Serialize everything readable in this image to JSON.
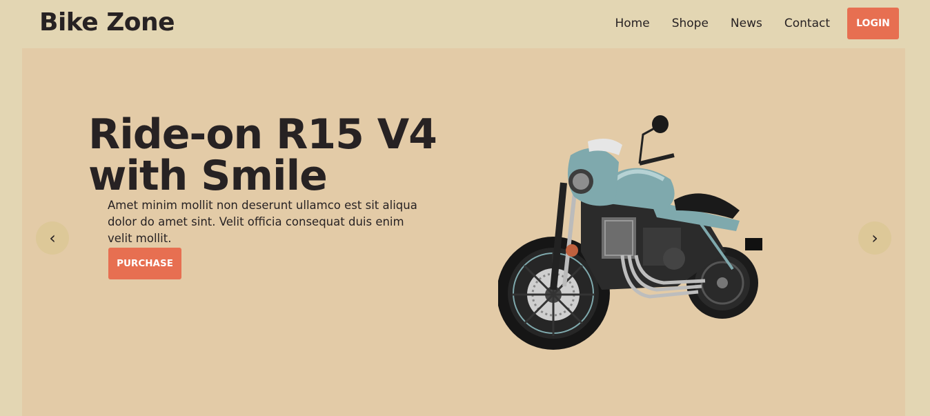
{
  "brand": {
    "name": "Bike Zone"
  },
  "nav": {
    "links": [
      "Home",
      "Shope",
      "News",
      "Contact"
    ],
    "login_label": "LOGIN"
  },
  "hero": {
    "title_line1": "Ride-on R15 V4",
    "title_line2": "with Smile",
    "text": "Amet minim mollit non deserunt ullamco est sit aliqua dolor do amet sint. Velit officia consequat duis enim velit mollit.",
    "purchase_label": "PURCHASE",
    "prev_icon": "‹",
    "next_icon": "›",
    "image": "motorcycle-image"
  },
  "colors": {
    "page_bg": "#e3d6b3",
    "hero_bg": "#e3cba7",
    "accent": "#e76f51",
    "text": "#272223",
    "bike_body": "#7fa9ad"
  }
}
